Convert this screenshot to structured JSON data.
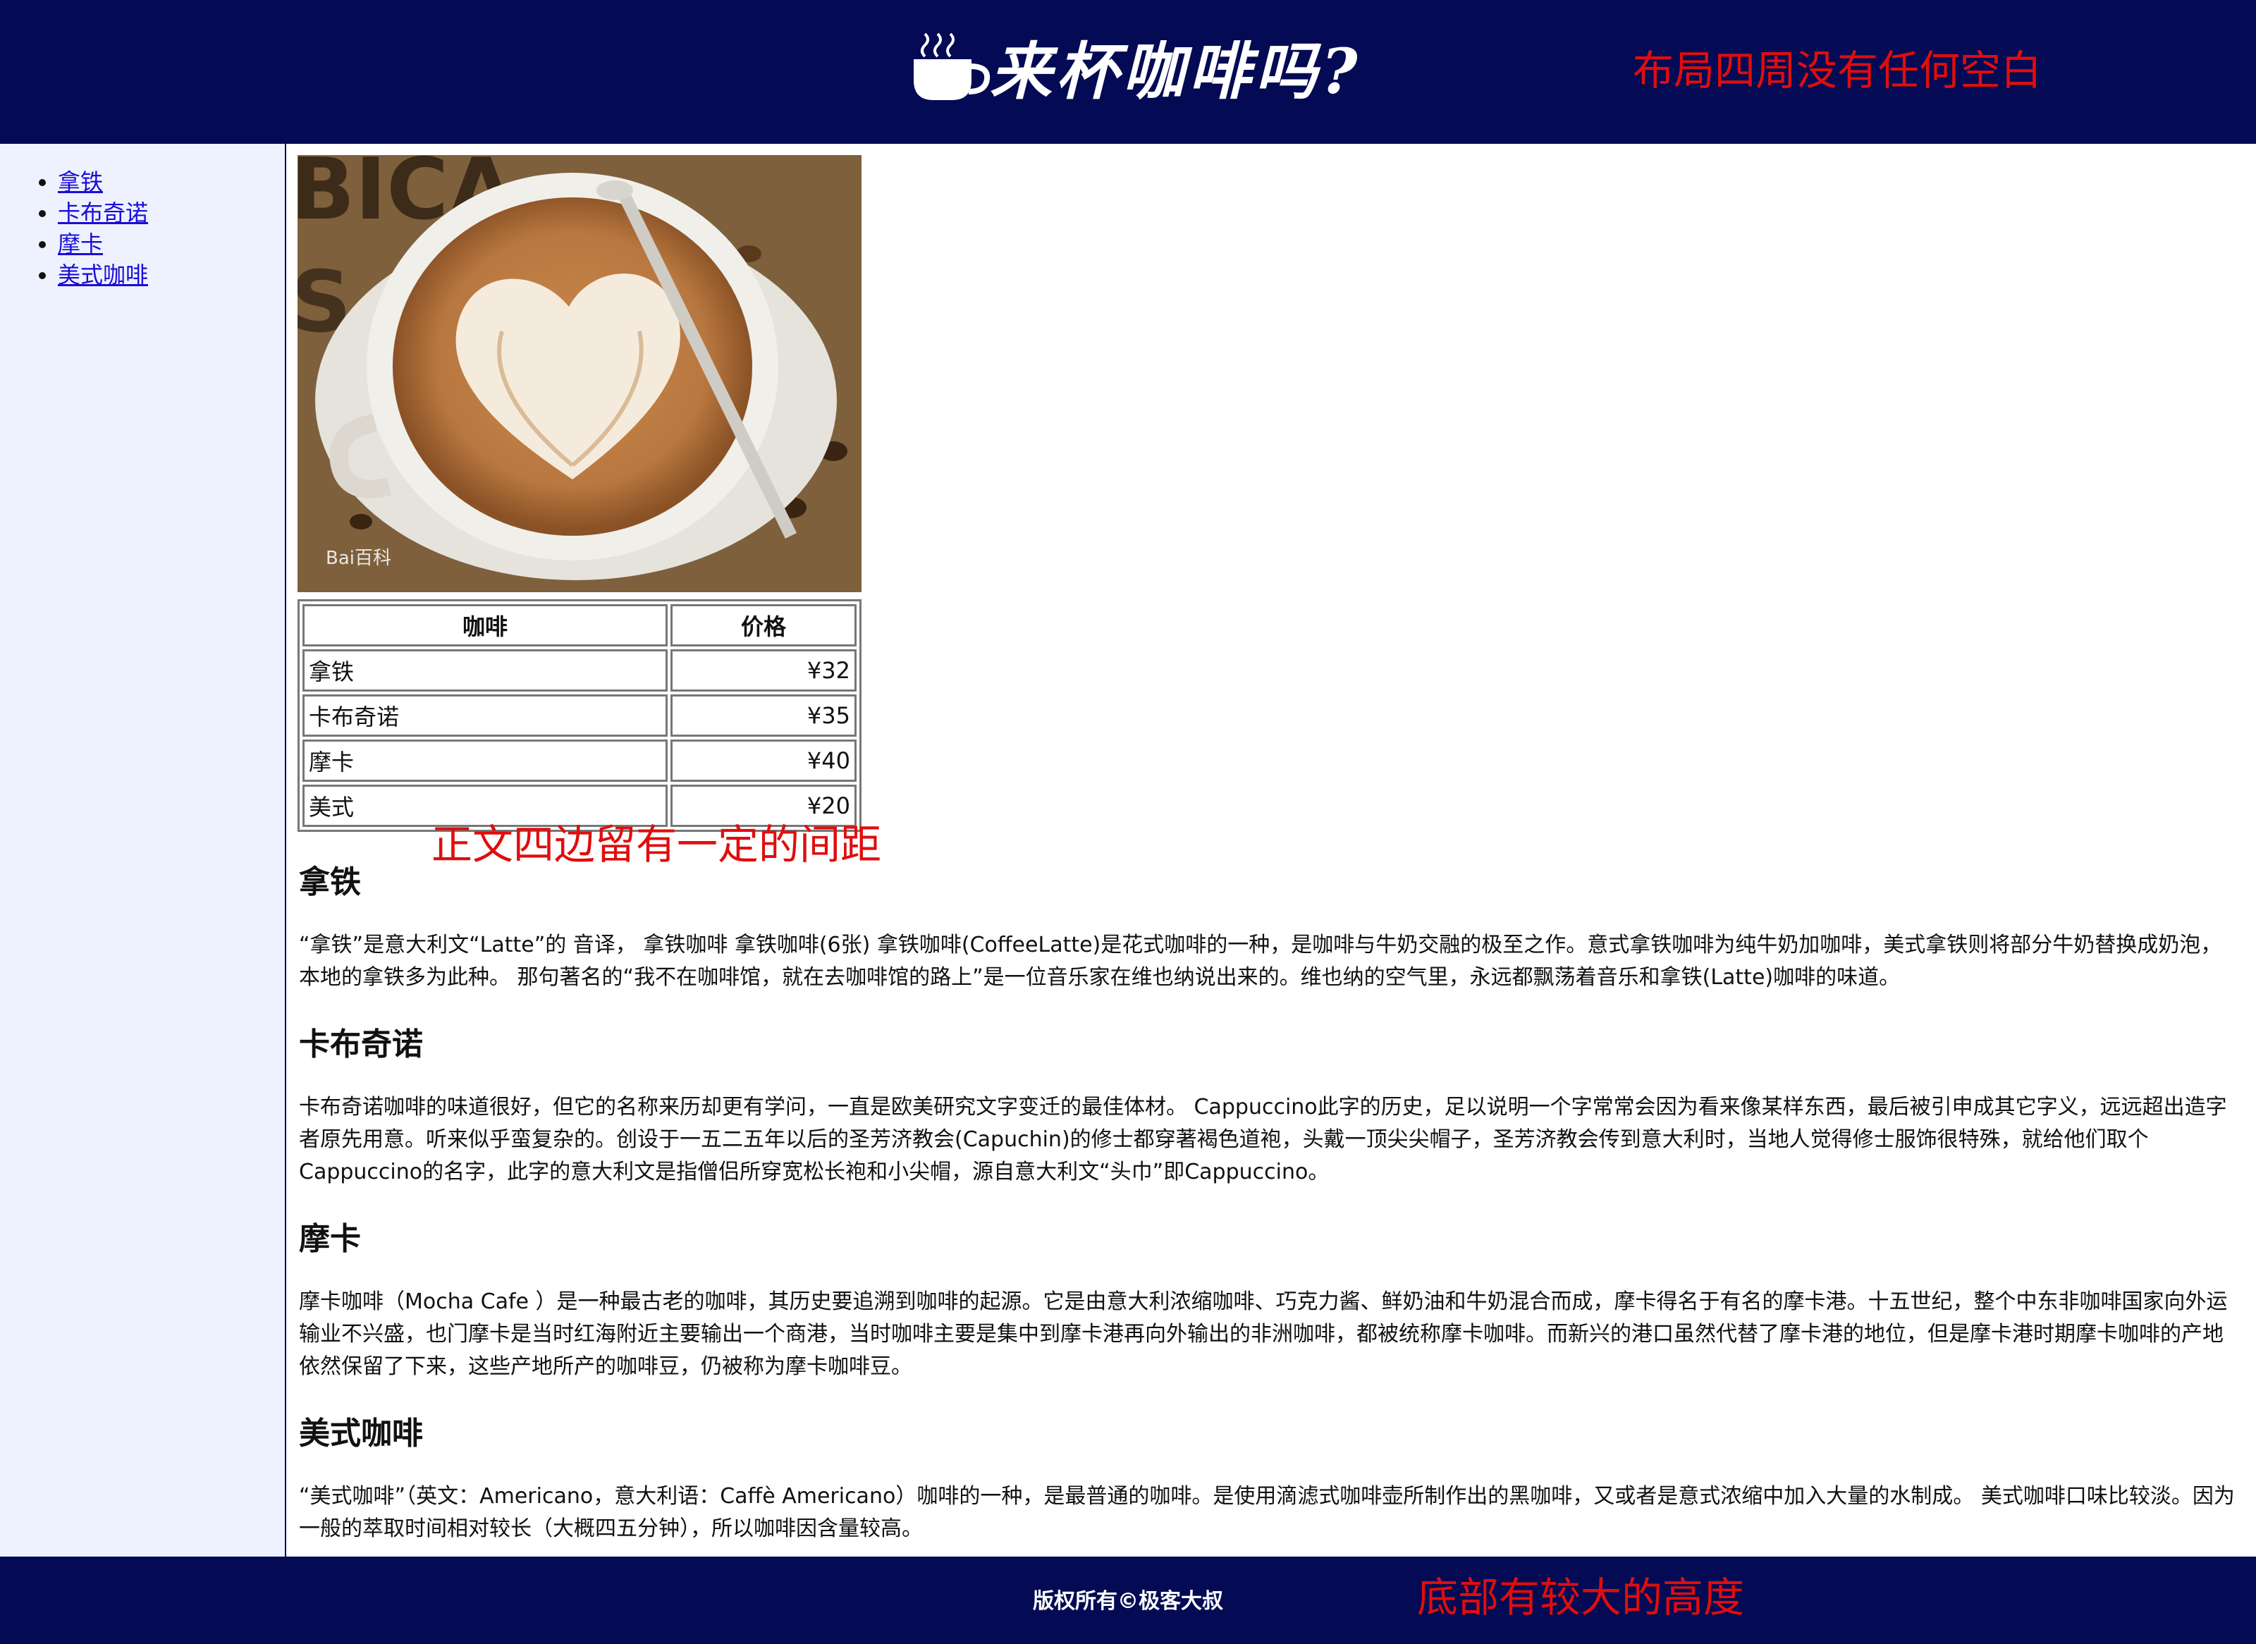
{
  "header": {
    "title": "来杯咖啡吗?",
    "annotation": "布局四周没有任何空白"
  },
  "sidebar": {
    "items": [
      {
        "label": "拿铁"
      },
      {
        "label": "卡布奇诺"
      },
      {
        "label": "摩卡"
      },
      {
        "label": "美式咖啡"
      }
    ]
  },
  "main": {
    "image_watermark": "Bai百科",
    "table": {
      "headers": [
        "咖啡",
        "价格"
      ],
      "rows": [
        {
          "name": "拿铁",
          "price": "¥32"
        },
        {
          "name": "卡布奇诺",
          "price": "¥35"
        },
        {
          "name": "摩卡",
          "price": "¥40"
        },
        {
          "name": "美式",
          "price": "¥20"
        }
      ]
    },
    "annotation": "正文四边留有一定的间距",
    "sections": [
      {
        "title": "拿铁",
        "text": "“拿铁”是意大利文“Latte”的 音译， 拿铁咖啡 拿铁咖啡(6张) 拿铁咖啡(CoffeeLatte)是花式咖啡的一种，是咖啡与牛奶交融的极至之作。意式拿铁咖啡为纯牛奶加咖啡，美式拿铁则将部分牛奶替换成奶泡，本地的拿铁多为此种。 那句著名的“我不在咖啡馆，就在去咖啡馆的路上”是一位音乐家在维也纳说出来的。维也纳的空气里，永远都飘荡着音乐和拿铁(Latte)咖啡的味道。"
      },
      {
        "title": "卡布奇诺",
        "text": "卡布奇诺咖啡的味道很好，但它的名称来历却更有学问，一直是欧美研究文字变迁的最佳体材。 Cappuccino此字的历史，足以说明一个字常常会因为看来像某样东西，最后被引申成其它字义，远远超出造字者原先用意。听来似乎蛮复杂的。创设于一五二五年以后的圣芳济教会(Capuchin)的修士都穿著褐色道袍，头戴一顶尖尖帽子，圣芳济教会传到意大利时，当地人觉得修士服饰很特殊，就给他们取个Cappuccino的名字，此字的意大利文是指僧侣所穿宽松长袍和小尖帽，源自意大利文“头巾”即Cappuccino。"
      },
      {
        "title": "摩卡",
        "text": "摩卡咖啡（Mocha Cafe ）是一种最古老的咖啡，其历史要追溯到咖啡的起源。它是由意大利浓缩咖啡、巧克力酱、鲜奶油和牛奶混合而成，摩卡得名于有名的摩卡港。十五世纪，整个中东非咖啡国家向外运输业不兴盛，也门摩卡是当时红海附近主要输出一个商港，当时咖啡主要是集中到摩卡港再向外输出的非洲咖啡，都被统称摩卡咖啡。而新兴的港口虽然代替了摩卡港的地位，但是摩卡港时期摩卡咖啡的产地依然保留了下来，这些产地所产的咖啡豆，仍被称为摩卡咖啡豆。"
      },
      {
        "title": "美式咖啡",
        "text": "“美式咖啡”（英文：Americano，意大利语：Caffè Americano）咖啡的一种，是最普通的咖啡。是使用滴滤式咖啡壶所制作出的黑咖啡，又或者是意式浓缩中加入大量的水制成。 美式咖啡口味比较淡。因为一般的萃取时间相对较长（大概四五分钟），所以咖啡因含量较高。"
      }
    ]
  },
  "footer": {
    "copyright": "版权所有©极客大叔",
    "annotation": "底部有较大的高度"
  },
  "colors": {
    "header_bg": "#040b54",
    "sidebar_bg": "#eef2ff",
    "annotation": "#e10d0d",
    "link": "#1a0dd8"
  }
}
